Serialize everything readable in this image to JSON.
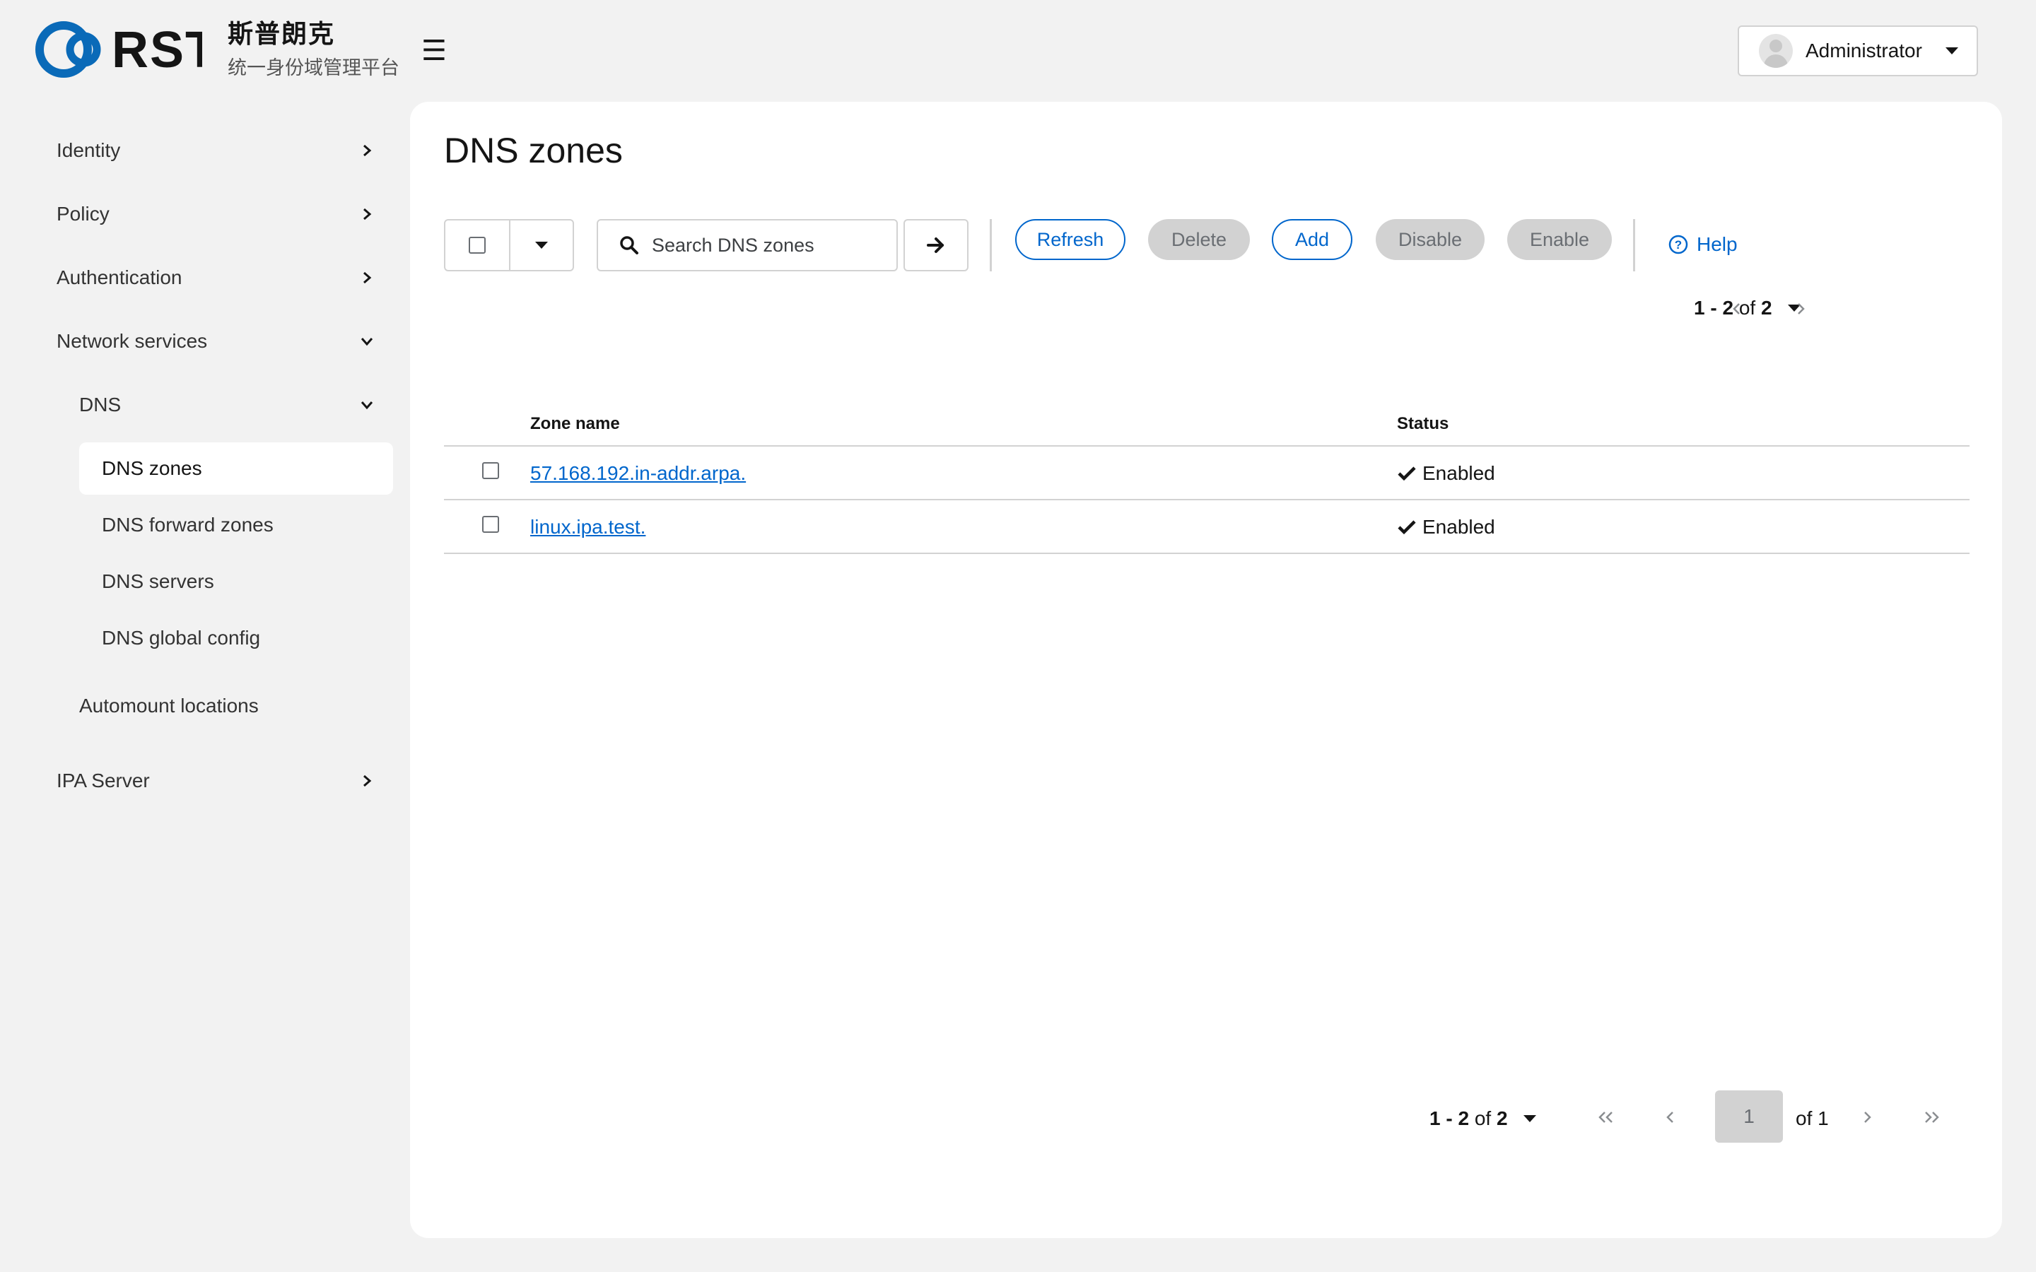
{
  "brand": {
    "logo_text": "RST",
    "name_cn": "斯普朗克",
    "subtitle_cn": "统一身份域管理平台"
  },
  "header": {
    "menu_icon": "hamburger-icon",
    "user_label": "Administrator"
  },
  "sidebar": {
    "items": [
      {
        "label": "Identity",
        "icon": "chevron-right-icon"
      },
      {
        "label": "Policy",
        "icon": "chevron-right-icon"
      },
      {
        "label": "Authentication",
        "icon": "chevron-right-icon"
      },
      {
        "label": "Network services",
        "icon": "chevron-down-icon"
      },
      {
        "label": "DNS",
        "icon": "chevron-down-icon"
      },
      {
        "label": "DNS zones",
        "active": true
      },
      {
        "label": "DNS forward zones"
      },
      {
        "label": "DNS servers"
      },
      {
        "label": "DNS global config"
      },
      {
        "label": "Automount locations"
      },
      {
        "label": "IPA Server",
        "icon": "chevron-right-icon"
      }
    ]
  },
  "main": {
    "title": "DNS zones",
    "search": {
      "placeholder": "Search DNS zones",
      "value": ""
    },
    "actions": {
      "refresh": "Refresh",
      "delete": "Delete",
      "add": "Add",
      "disable": "Disable",
      "enable": "Enable",
      "help": "Help"
    },
    "pagination": {
      "range": "1 - 2",
      "of_word": "of",
      "total": "2",
      "current_page": "1",
      "page_count_label": "of 1"
    },
    "table": {
      "columns": [
        "Zone name",
        "Status"
      ],
      "rows": [
        {
          "zone": "57.168.192.in-addr.arpa.",
          "status": "Enabled"
        },
        {
          "zone": "linux.ipa.test.",
          "status": "Enabled"
        }
      ]
    }
  },
  "colors": {
    "link": "#0066cc",
    "logo_blue": "#0a6ab8",
    "disabled_bg": "#d2d2d2",
    "page_bg": "#f2f2f2"
  }
}
